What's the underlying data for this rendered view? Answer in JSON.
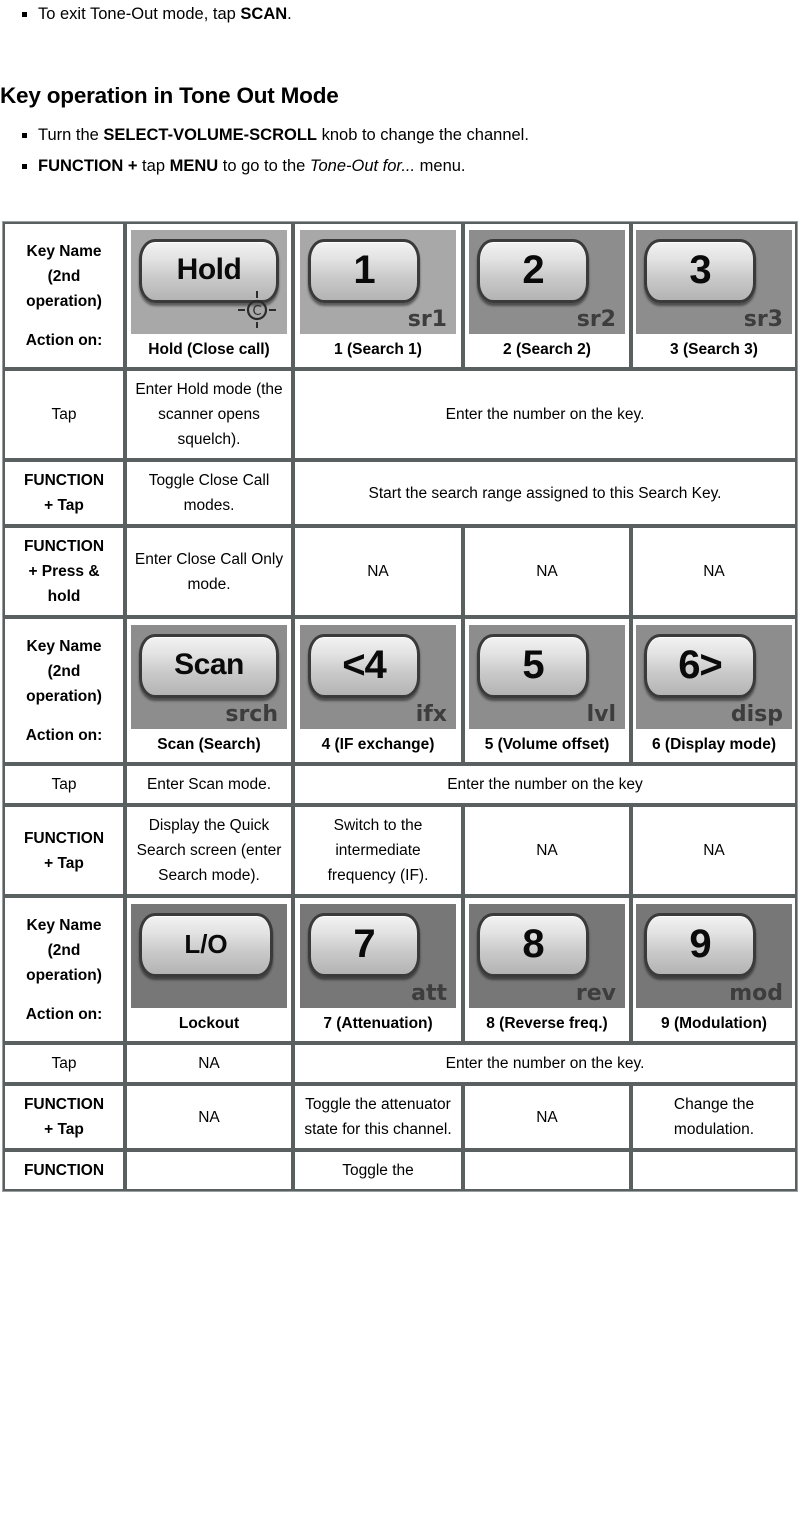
{
  "intro": {
    "pre_bullets": [
      {
        "parts": [
          {
            "t": "To exit Tone-Out mode, tap ",
            "b": false
          },
          {
            "t": "SCAN",
            "b": true
          },
          {
            "t": ".",
            "b": false
          }
        ]
      }
    ],
    "heading": "Key operation in Tone Out Mode",
    "post_bullets": [
      {
        "parts": [
          {
            "t": "Turn the ",
            "b": false
          },
          {
            "t": "SELECT-VOLUME-SCROLL",
            "b": true
          },
          {
            "t": " knob to change the channel.",
            "b": false
          }
        ]
      },
      {
        "parts": [
          {
            "t": "FUNCTION +",
            "b": true
          },
          {
            "t": " tap ",
            "b": false
          },
          {
            "t": "MENU",
            "b": true
          },
          {
            "t": " to go to the ",
            "b": false
          },
          {
            "t": "Tone-Out for...",
            "b": false,
            "i": true
          },
          {
            "t": " menu.",
            "b": false
          }
        ]
      }
    ]
  },
  "table": {
    "row_header_label_line1": "Key Name (2nd operation)",
    "row_header_label_line2": "Action on:",
    "groups": [
      {
        "keys": [
          {
            "cap": "Hold (Close call)",
            "glyph": "Hold",
            "sub": "",
            "icon": "close-call-crosshair-icon",
            "style": "word",
            "bg": "light"
          },
          {
            "cap": "1 (Search 1)",
            "glyph": "1",
            "sub": "sr1",
            "icon": "",
            "style": "num",
            "bg": "light"
          },
          {
            "cap": "2 (Search 2)",
            "glyph": "2",
            "sub": "sr2",
            "icon": "",
            "style": "num",
            "bg": "mid"
          },
          {
            "cap": "3 (Search 3)",
            "glyph": "3",
            "sub": "sr3",
            "icon": "",
            "style": "num",
            "bg": "mid"
          }
        ],
        "rows": [
          {
            "action": "Tap",
            "action_bold": false,
            "cells": [
              {
                "text": "Enter Hold mode (the scanner opens squelch)."
              },
              {
                "text": "Enter the number on the key.",
                "span": 3
              }
            ]
          },
          {
            "action": "FUNCTION + Tap",
            "action_bold": true,
            "action_b1": "FUNCTION",
            "action_b2": "+ Tap",
            "cells": [
              {
                "text": "Toggle Close Call modes."
              },
              {
                "text": "Start the search range assigned to this Search Key.",
                "span": 3
              }
            ]
          },
          {
            "action": "FUNCTION + Press & hold",
            "action_bold": true,
            "action_b1": "FUNCTION",
            "action_b2": "+ Press & hold",
            "cells": [
              {
                "text": "Enter Close Call Only mode."
              },
              {
                "text": "NA"
              },
              {
                "text": "NA"
              },
              {
                "text": "NA"
              }
            ]
          }
        ]
      },
      {
        "keys": [
          {
            "cap": "Scan (Search)",
            "glyph": "Scan",
            "sub": "srch",
            "icon": "",
            "style": "word",
            "bg": "mid"
          },
          {
            "cap": "4 (IF exchange)",
            "glyph": "<4",
            "sub": "ifx",
            "icon": "",
            "style": "num",
            "bg": "mid"
          },
          {
            "cap": "5 (Volume offset)",
            "glyph": "5",
            "sub": "lvl",
            "icon": "",
            "style": "num",
            "bg": "mid"
          },
          {
            "cap": "6 (Display mode)",
            "glyph": "6>",
            "sub": "disp",
            "icon": "",
            "style": "num",
            "bg": "mid"
          }
        ],
        "rows": [
          {
            "action": "Tap",
            "action_bold": false,
            "cells": [
              {
                "text": "Enter Scan mode."
              },
              {
                "text": "Enter the number on the key",
                "span": 3
              }
            ]
          },
          {
            "action": "FUNCTION + Tap",
            "action_bold": true,
            "action_b1": "FUNCTION",
            "action_b2": "+ Tap",
            "cells": [
              {
                "text": "Display the Quick Search screen (enter Search mode)."
              },
              {
                "text": "Switch to the intermediate frequency (IF)."
              },
              {
                "text": "NA"
              },
              {
                "text": "NA"
              }
            ]
          }
        ]
      },
      {
        "keys": [
          {
            "cap": "Lockout",
            "glyph": "L/O",
            "sub": "",
            "icon": "",
            "style": "word-sm",
            "bg": "dark"
          },
          {
            "cap": "7 (Attenuation)",
            "glyph": "7",
            "sub": "att",
            "icon": "",
            "style": "num",
            "bg": "dark"
          },
          {
            "cap": "8 (Reverse freq.)",
            "glyph": "8",
            "sub": "rev",
            "icon": "",
            "style": "num",
            "bg": "dark"
          },
          {
            "cap": "9 (Modulation)",
            "glyph": "9",
            "sub": "mod",
            "icon": "",
            "style": "num",
            "bg": "dark"
          }
        ],
        "rows": [
          {
            "action": "Tap",
            "action_bold": false,
            "cells": [
              {
                "text": "NA"
              },
              {
                "text": "Enter the number on the key.",
                "span": 3
              }
            ]
          },
          {
            "action": "FUNCTION + Tap",
            "action_bold": true,
            "action_b1": "FUNCTION",
            "action_b2": "+ Tap",
            "cells": [
              {
                "text": "NA"
              },
              {
                "text": "Toggle the attenuator state for this channel."
              },
              {
                "text": "NA"
              },
              {
                "text": "Change the modulation."
              }
            ]
          },
          {
            "action": "FUNCTION",
            "action_bold": true,
            "action_b1": "FUNCTION",
            "action_b2": "",
            "cells": [
              {
                "text": ""
              },
              {
                "text": "Toggle the"
              },
              {
                "text": ""
              },
              {
                "text": ""
              }
            ],
            "clipped": true
          }
        ]
      }
    ]
  },
  "colors": {
    "header_bg": "#d6e7ec",
    "keycap_light": "#a8a8a8",
    "keycap_mid": "#8d8d8d",
    "keycap_dark": "#777777",
    "border": "#5a5f5f",
    "text": "#000000"
  }
}
